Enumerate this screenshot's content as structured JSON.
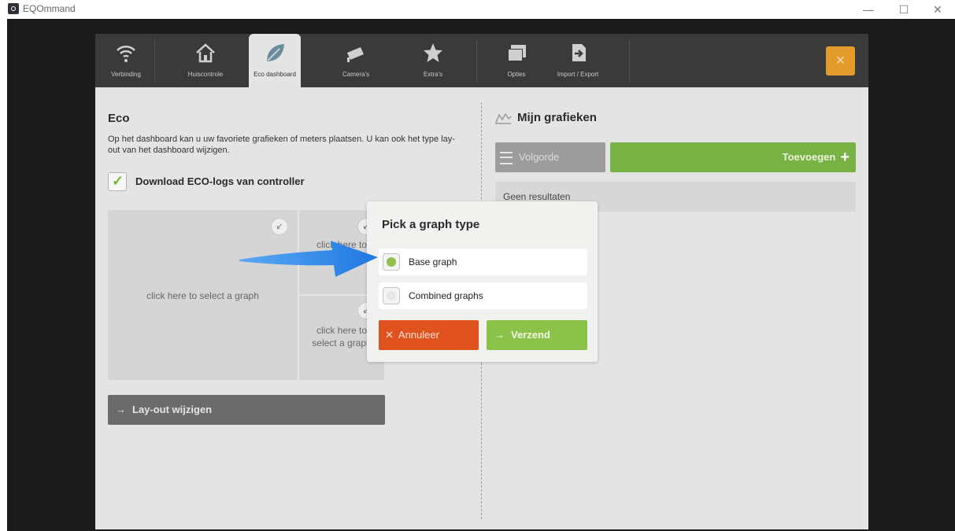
{
  "window": {
    "title": "EQOmmand",
    "min_label": "—",
    "max_label": "☐",
    "close_label": "✕"
  },
  "tabs": [
    {
      "label": "Verbinding",
      "icon": "wifi-icon",
      "active": false
    },
    {
      "label": "Huiscontrole",
      "icon": "home-icon",
      "active": false
    },
    {
      "label": "Eco dashboard",
      "icon": "leaf-icon",
      "active": true
    },
    {
      "label": "Camera's",
      "icon": "camera-icon",
      "active": false
    },
    {
      "label": "Extra's",
      "icon": "star-icon",
      "active": false
    },
    {
      "label": "Opties",
      "icon": "windows-icon",
      "active": false
    },
    {
      "label": "Import / Export",
      "icon": "import-export-icon",
      "active": false
    }
  ],
  "close_button_label": "✕",
  "eco": {
    "title": "Eco",
    "description": "Op het dashboard kan u uw favoriete grafieken of meters plaatsen. U kan ook het type lay-out van het dashboard wijzigen.",
    "download_checkbox": {
      "label": "Download ECO-logs van controller",
      "checked": true
    },
    "slots": {
      "big": "click here to select a graph",
      "top_right": "click here to select a graph",
      "bottom_right_line1": "click here to",
      "bottom_right_line2": "select a graph"
    },
    "layout_button": "Lay-out wijzigen"
  },
  "graphs": {
    "title": "Mijn grafieken",
    "order_button": "Volgorde",
    "add_button": "Toevoegen",
    "empty_text": "Geen resultaten"
  },
  "dialog": {
    "title": "Pick a graph type",
    "options": [
      {
        "label": "Base graph",
        "selected": true
      },
      {
        "label": "Combined graphs",
        "selected": false
      }
    ],
    "cancel": "Annuleer",
    "send": "Verzend"
  },
  "colors": {
    "accent_orange": "#e39c2c",
    "green": "#78b244",
    "cancel_red": "#e0531f",
    "send_green": "#8bc34a",
    "annotation_blue": "#2f8ae8"
  }
}
